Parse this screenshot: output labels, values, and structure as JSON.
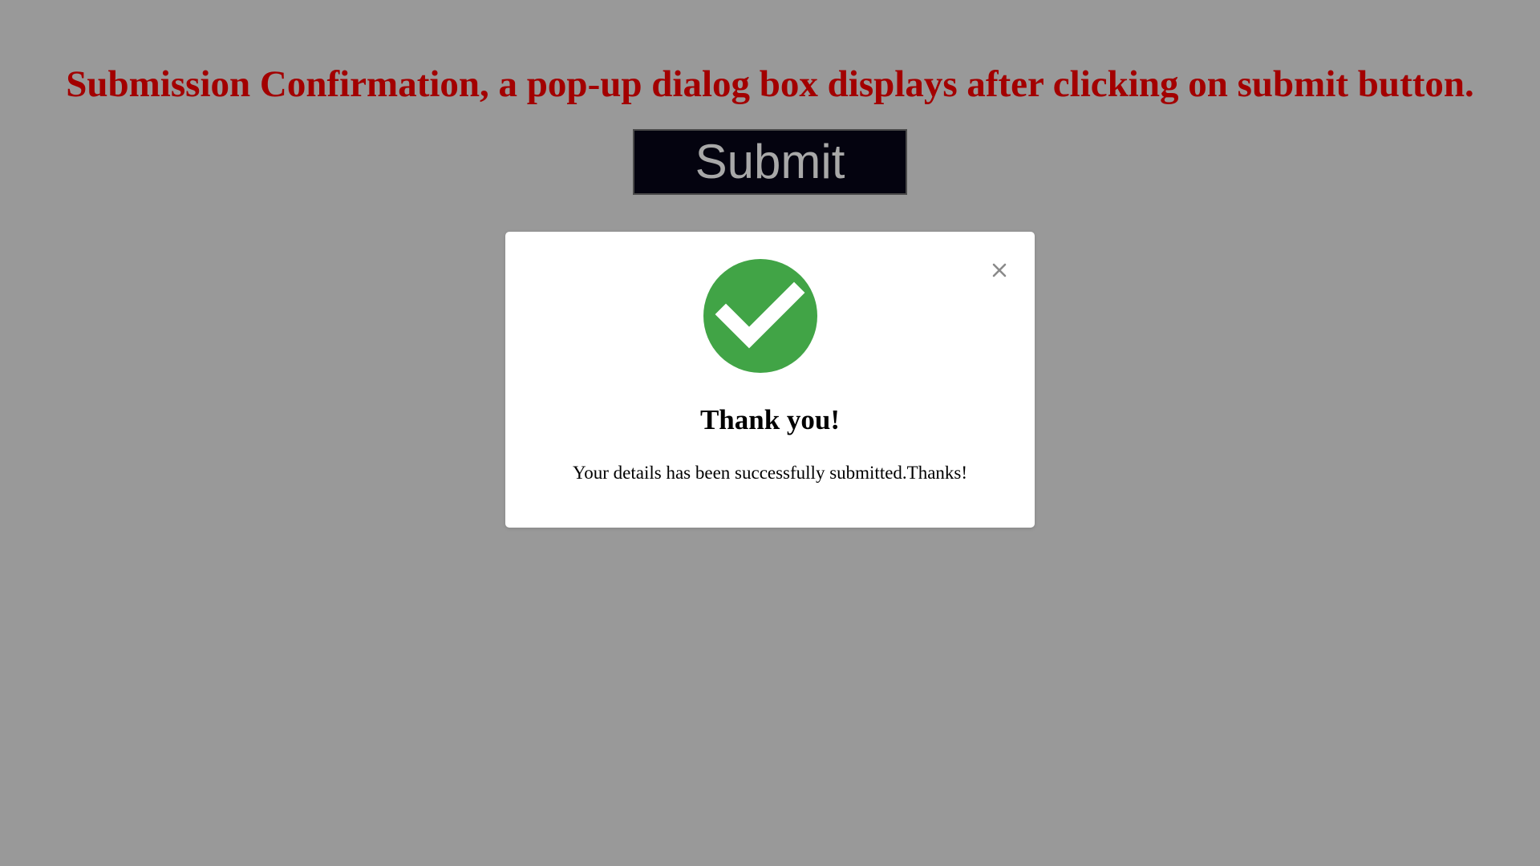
{
  "page": {
    "heading": "Submission Confirmation, a pop-up dialog box displays after clicking on submit button.",
    "submit_label": "Submit"
  },
  "modal": {
    "icon": "check-circle-icon",
    "close_icon": "close-icon",
    "title": "Thank you!",
    "message": "Your details has been successfully submitted.Thanks!"
  },
  "colors": {
    "background": "#999999",
    "heading": "#a30000",
    "button_background": "#04030f",
    "button_text": "#a8a8a8",
    "success": "#41a446",
    "modal_background": "#ffffff"
  }
}
